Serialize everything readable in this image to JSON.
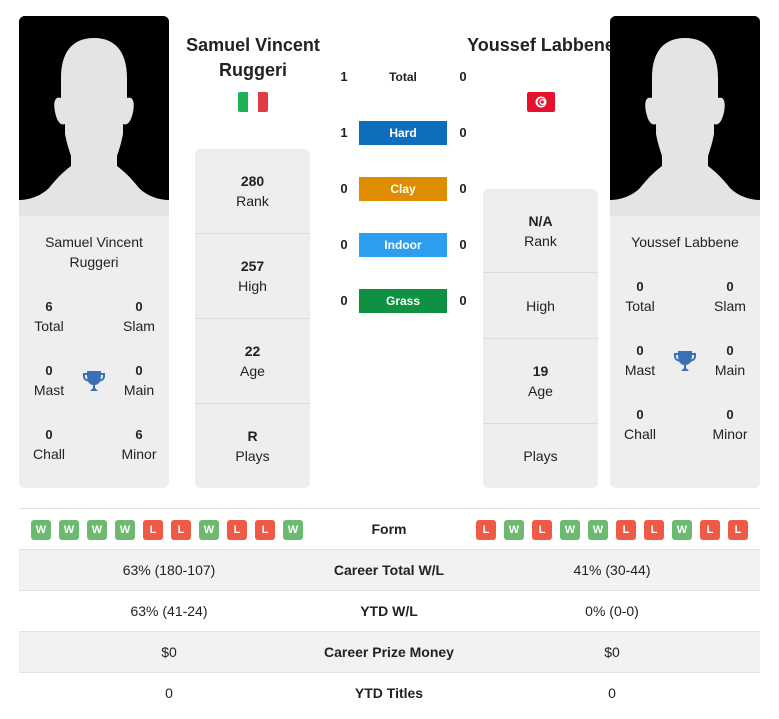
{
  "player1": {
    "name": "Samuel Vincent Ruggeri",
    "card_name": "Samuel Vincent Ruggeri",
    "country_flag": "italy-flag",
    "stats": [
      {
        "value": "280",
        "label": "Rank"
      },
      {
        "value": "257",
        "label": "High"
      },
      {
        "value": "22",
        "label": "Age"
      },
      {
        "value": "R",
        "label": "Plays"
      }
    ],
    "titles": {
      "total": {
        "value": "6",
        "label": "Total"
      },
      "slam": {
        "value": "0",
        "label": "Slam"
      },
      "mast": {
        "value": "0",
        "label": "Mast"
      },
      "main": {
        "value": "0",
        "label": "Main"
      },
      "chall": {
        "value": "0",
        "label": "Chall"
      },
      "minor": {
        "value": "6",
        "label": "Minor"
      }
    },
    "form": [
      "W",
      "W",
      "W",
      "W",
      "L",
      "L",
      "W",
      "L",
      "L",
      "W"
    ]
  },
  "player2": {
    "name": "Youssef Labbene",
    "card_name": "Youssef Labbene",
    "country_flag": "tunisia-flag",
    "stats": [
      {
        "value": "N/A",
        "label": "Rank"
      },
      {
        "value": "",
        "label": "High"
      },
      {
        "value": "19",
        "label": "Age"
      },
      {
        "value": "",
        "label": "Plays"
      }
    ],
    "titles": {
      "total": {
        "value": "0",
        "label": "Total"
      },
      "slam": {
        "value": "0",
        "label": "Slam"
      },
      "mast": {
        "value": "0",
        "label": "Mast"
      },
      "main": {
        "value": "0",
        "label": "Main"
      },
      "chall": {
        "value": "0",
        "label": "Chall"
      },
      "minor": {
        "value": "0",
        "label": "Minor"
      }
    },
    "form": [
      "L",
      "W",
      "L",
      "W",
      "W",
      "L",
      "L",
      "W",
      "L",
      "L"
    ]
  },
  "h2h": [
    {
      "label": "Total",
      "p1": "1",
      "p2": "0",
      "color": ""
    },
    {
      "label": "Hard",
      "p1": "1",
      "p2": "0",
      "color": "#0d6ebd"
    },
    {
      "label": "Clay",
      "p1": "0",
      "p2": "0",
      "color": "#de8c00"
    },
    {
      "label": "Indoor",
      "p1": "0",
      "p2": "0",
      "color": "#2d9df0"
    },
    {
      "label": "Grass",
      "p1": "0",
      "p2": "0",
      "color": "#0f9142"
    }
  ],
  "comparison": {
    "form_label": "Form",
    "rows": [
      {
        "label": "Career Total W/L",
        "p1": "63% (180-107)",
        "p2": "41% (30-44)"
      },
      {
        "label": "YTD W/L",
        "p1": "63% (41-24)",
        "p2": "0% (0-0)"
      },
      {
        "label": "Career Prize Money",
        "p1": "$0",
        "p2": "$0"
      },
      {
        "label": "YTD Titles",
        "p1": "0",
        "p2": "0"
      }
    ]
  },
  "colors": {
    "win": "#6cba6f",
    "loss": "#ee5a45",
    "trophy": "#3b6fb6",
    "italy_green": "#1fb155",
    "italy_red": "#e23b45",
    "tunisia_red": "#e8112d"
  }
}
